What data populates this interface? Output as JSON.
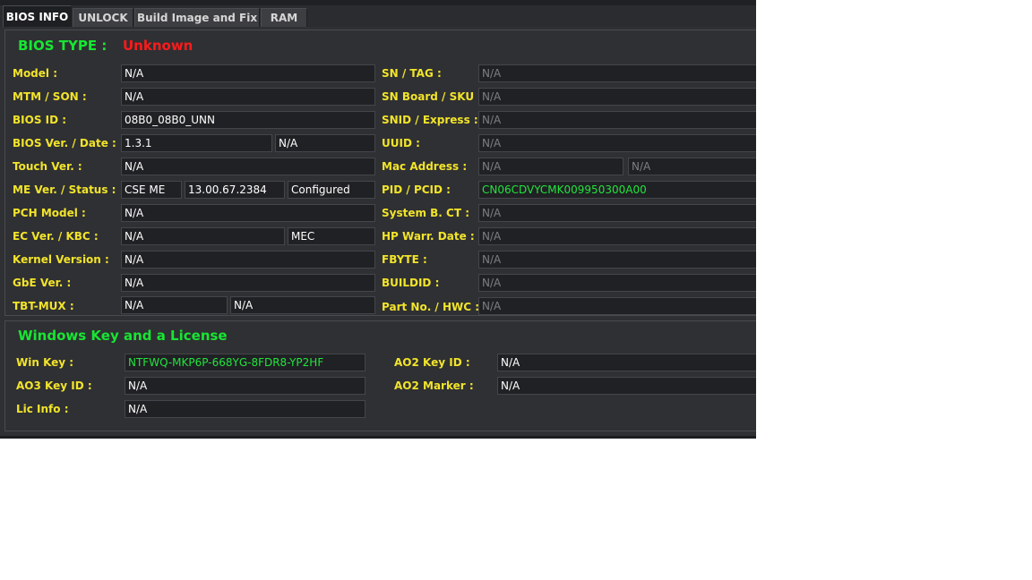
{
  "tabs": [
    {
      "label": "BIOS INFO",
      "active": true
    },
    {
      "label": "UNLOCK",
      "active": false
    },
    {
      "label": "Build Image and Fix",
      "active": false
    },
    {
      "label": "RAM",
      "active": false
    }
  ],
  "bios_type": {
    "title": "BIOS TYPE :",
    "value": "Unknown"
  },
  "left_fields": {
    "model": {
      "label": "Model :",
      "value": "N/A"
    },
    "mtm_son": {
      "label": "MTM / SON :",
      "value": "N/A"
    },
    "bios_id": {
      "label": "BIOS ID :",
      "value": "08B0_08B0_UNN"
    },
    "bios_ver_date": {
      "label": "BIOS Ver. / Date :",
      "ver": "1.3.1",
      "date": "N/A"
    },
    "touch_ver": {
      "label": "Touch Ver. :",
      "value": "N/A"
    },
    "me_ver_status": {
      "label": "ME Ver. / Status :",
      "type": "CSE ME",
      "version": "13.00.67.2384",
      "status": "Configured"
    },
    "pch_model": {
      "label": "PCH Model :",
      "value": "N/A"
    },
    "ec_ver_kbc": {
      "label": "EC Ver. / KBC :",
      "ec": "N/A",
      "kbc": "MEC"
    },
    "kernel_version": {
      "label": "Kernel Version :",
      "value": "N/A"
    },
    "gbe_ver": {
      "label": "GbE Ver. :",
      "value": "N/A"
    },
    "tbt_mux": {
      "label": "TBT-MUX :",
      "tbt": "N/A",
      "mux": "N/A"
    }
  },
  "right_fields": {
    "sn_tag": {
      "label": "SN / TAG :",
      "value": "N/A"
    },
    "sn_board_sku": {
      "label": "SN Board / SKU :",
      "value": "N/A"
    },
    "snid_express": {
      "label": "SNID / Express :",
      "value": "N/A"
    },
    "uuid": {
      "label": "UUID :",
      "value": "N/A"
    },
    "mac_address": {
      "label": "Mac Address :",
      "value1": "N/A",
      "value2": "N/A"
    },
    "pid_pcid": {
      "label": "PID / PCID :",
      "value": "CN06CDVYCMK009950300A00"
    },
    "system_b_ct": {
      "label": "System B. CT :",
      "value": "N/A"
    },
    "hp_warr_date": {
      "label": "HP Warr. Date :",
      "value": "N/A"
    },
    "fbyte": {
      "label": "FBYTE :",
      "value": "N/A"
    },
    "buildid": {
      "label": "BUILDID :",
      "value": "N/A"
    },
    "part_no_hwc": {
      "label": "Part No. / HWC :",
      "value": "N/A"
    }
  },
  "windows": {
    "title": "Windows Key and a License",
    "win_key": {
      "label": "Win Key :",
      "value": "NTFWQ-MKP6P-668YG-8FDR8-YP2HF"
    },
    "ao3_key_id": {
      "label": "AO3 Key ID :",
      "value": "N/A"
    },
    "lic_info": {
      "label": "Lic Info  :",
      "value": "N/A"
    },
    "ao2_key_id": {
      "label": "AO2 Key ID :",
      "value": "N/A"
    },
    "ao2_marker": {
      "label": "AO2 Marker  :",
      "value": "N/A"
    }
  },
  "colors": {
    "label": "#f2e42a",
    "title_green": "#17e632",
    "unknown_red": "#ff1a1a",
    "field_bg": "#202124",
    "panel_bg": "#2f3033"
  }
}
